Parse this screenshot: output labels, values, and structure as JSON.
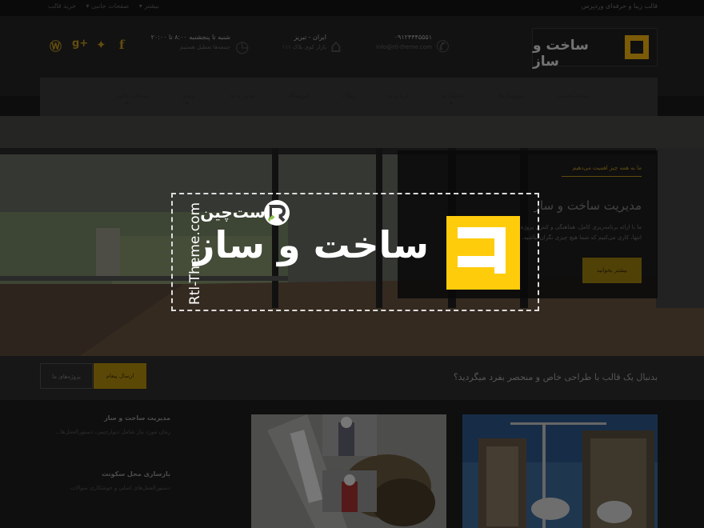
{
  "topbar": {
    "left_links": [
      "بیشتر ▾",
      "صفحات جانبی ▾",
      "خرید قالب"
    ],
    "right_text": "قالب زیبا و حرفه‌ای وردپرس"
  },
  "header": {
    "logo_text": "ساخت و ساز",
    "contact": {
      "phone": "۰۹۱۲۴۴۴۵۵۵۱",
      "email": "info@rtl-theme.com"
    },
    "address": {
      "line1": "ایران - تبریز",
      "line2": "بازار کوی بلاک ۱۱۱"
    },
    "hours": {
      "line1": "شنبه تا پنجشنبه ۸:۰۰ تا ۲۰:۰۰",
      "line2": "جمعه‌ها تعطیل هستیم"
    },
    "social_icons": [
      "wordpress-icon",
      "google-plus-icon",
      "twitter-icon",
      "facebook-icon"
    ]
  },
  "nav": {
    "items": [
      "صفحه نخست",
      "نمونه‌کارها",
      "خدمات ما",
      "درباره ما",
      "وبلاگ",
      "فروشگاه",
      "تماس با ما",
      "بیشتر",
      "صفحات جانبی"
    ]
  },
  "slider": {
    "kicker": "ما به همه چیز اهمیت می‌دهیم",
    "title": "مدیریت ساخت و ساز",
    "body": "ما با ارائه برنامه‌ریزی کامل، هماهنگی و کنترل پروژه از ابتدا تا انتها، کاری می‌کنیم که شما هیچ چیزی نگران نباشید.",
    "button": "بیشتر بخوانید"
  },
  "watermark": {
    "big_text": "ساخت و ساز",
    "brand": "راست‌چین",
    "url": "Rtl-Theme.com"
  },
  "cta": {
    "text": "بدنبال یک قالب با طراحی خاص و منحصر بفرد میگردید؟",
    "button_primary": "ارسال پیغام",
    "button_secondary": "پروژه‌های ما"
  },
  "services": [
    {
      "title": "مدیریت ساخت و ساز",
      "desc": "زمان مورد نیاز شامل دیوارچینی، دستورالعمل‌ها..."
    },
    {
      "title": "بازسازی محل سکونت",
      "desc": "دستورالعمل‌های اصلی و جوشکاری سوالات"
    }
  ]
}
